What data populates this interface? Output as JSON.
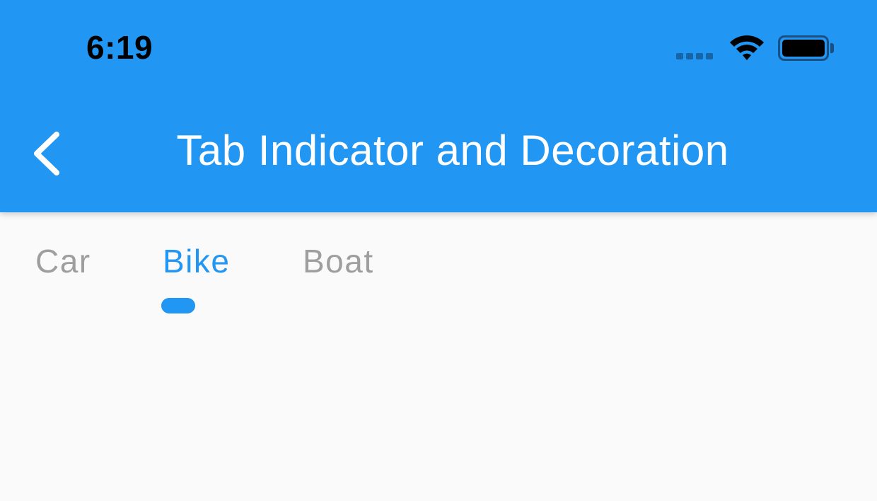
{
  "status_bar": {
    "time": "6:19",
    "icons": [
      "signal-icon",
      "wifi-icon",
      "battery-icon"
    ]
  },
  "app_bar": {
    "title": "Tab Indicator and Decoration",
    "back_icon": "chevron-left-icon",
    "background_color": "#2196f3"
  },
  "tabs": {
    "items": [
      {
        "label": "Car"
      },
      {
        "label": "Bike"
      },
      {
        "label": "Boat"
      }
    ],
    "selected": "Bike",
    "active_color": "#2196f3",
    "inactive_color": "#9e9e9e"
  }
}
